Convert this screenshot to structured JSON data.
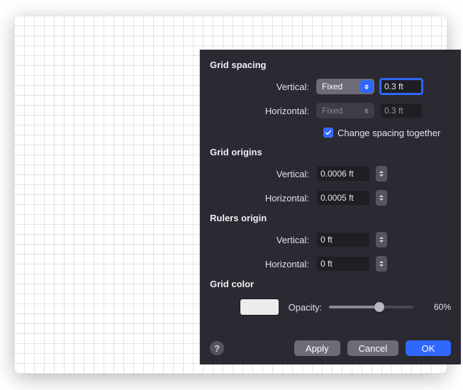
{
  "sections": {
    "grid_spacing_title": "Grid spacing",
    "grid_origins_title": "Grid origins",
    "rulers_origin_title": "Rulers origin",
    "grid_color_title": "Grid color"
  },
  "labels": {
    "vertical": "Vertical:",
    "horizontal": "Horizontal:",
    "opacity": "Opacity:"
  },
  "spacing": {
    "vertical_mode": "Fixed",
    "vertical_value": "0.3 ft",
    "horizontal_mode": "Fixed",
    "horizontal_value": "0.3 ft",
    "change_together_label": "Change spacing together",
    "change_together_checked": true
  },
  "origins": {
    "vertical": "0.0006 ft",
    "horizontal": "0.0005 ft"
  },
  "rulers": {
    "vertical": "0 ft",
    "horizontal": "0 ft"
  },
  "color": {
    "swatch_hex": "#ececec",
    "opacity_percent": 60,
    "opacity_text": "60%"
  },
  "buttons": {
    "help": "?",
    "apply": "Apply",
    "cancel": "Cancel",
    "ok": "OK"
  }
}
